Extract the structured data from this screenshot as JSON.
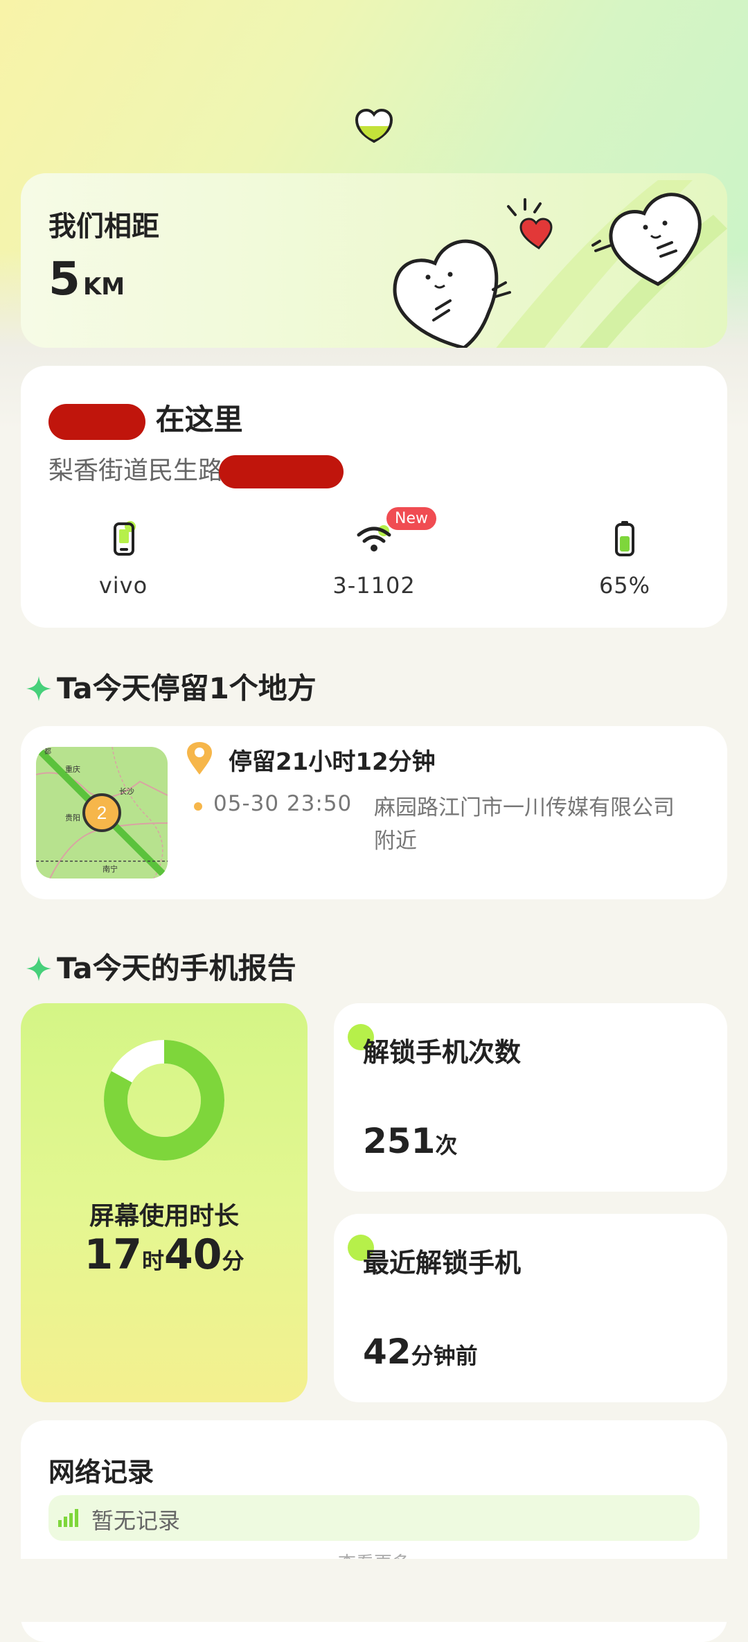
{
  "distance": {
    "title": "我们相距",
    "value": "5",
    "unit": "KM"
  },
  "location": {
    "title_suffix": "在这里",
    "address": "梨香街道民生路",
    "stats": [
      {
        "icon": "phone-icon",
        "label": "vivo"
      },
      {
        "icon": "wifi-icon",
        "label": "3-1102",
        "badge": "New"
      },
      {
        "icon": "battery-icon",
        "label": "65%",
        "battery_level": 0.65
      }
    ]
  },
  "stay_section": {
    "title": "Ta今天停留1个地方"
  },
  "stay": {
    "map_count": "2",
    "map_labels": [
      "重庆",
      "贵阳",
      "长沙",
      "南宁",
      "都"
    ],
    "title": "停留21小时12分钟",
    "time": "05-30 23:50",
    "place": "麻园路江门市一川传媒有限公司 附近"
  },
  "report_section": {
    "title": "Ta今天的手机报告"
  },
  "screen_time": {
    "label": "屏幕使用时长",
    "hours": "17",
    "hours_unit": "时",
    "minutes": "40",
    "minutes_unit": "分",
    "ring_fraction": 0.83
  },
  "unlock_count": {
    "title": "解锁手机次数",
    "value": "251",
    "unit": "次"
  },
  "last_unlock": {
    "title": "最近解锁手机",
    "value": "42",
    "unit": "分钟前"
  },
  "network": {
    "title": "网络记录",
    "empty": "暂无记录",
    "more": "查看更多"
  },
  "colors": {
    "accent_green": "#7ed63b",
    "badge_red": "#f04c52",
    "pin_orange": "#f6b64a"
  }
}
